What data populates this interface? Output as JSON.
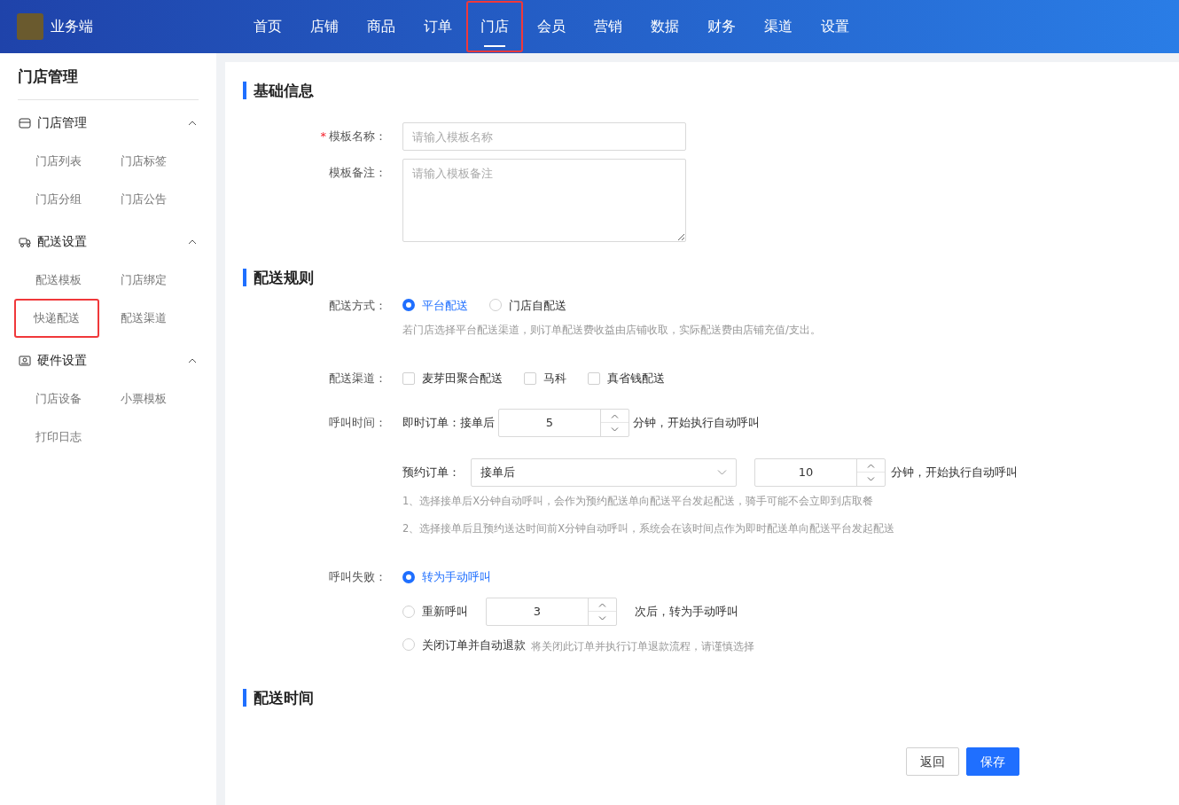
{
  "header": {
    "brand": "业务端",
    "nav": [
      {
        "label": "首页",
        "selected": false,
        "highlighted": false
      },
      {
        "label": "店铺",
        "selected": false,
        "highlighted": false
      },
      {
        "label": "商品",
        "selected": false,
        "highlighted": false
      },
      {
        "label": "订单",
        "selected": false,
        "highlighted": false
      },
      {
        "label": "门店",
        "selected": true,
        "highlighted": true
      },
      {
        "label": "会员",
        "selected": false,
        "highlighted": false
      },
      {
        "label": "营销",
        "selected": false,
        "highlighted": false
      },
      {
        "label": "数据",
        "selected": false,
        "highlighted": false
      },
      {
        "label": "财务",
        "selected": false,
        "highlighted": false
      },
      {
        "label": "渠道",
        "selected": false,
        "highlighted": false
      },
      {
        "label": "设置",
        "selected": false,
        "highlighted": false
      }
    ]
  },
  "sidebar": {
    "title": "门店管理",
    "groups": [
      {
        "label": "门店管理",
        "kind": "store",
        "expanded": true,
        "items": [
          {
            "label": "门店列表",
            "highlighted": false
          },
          {
            "label": "门店标签",
            "highlighted": false
          },
          {
            "label": "门店分组",
            "highlighted": false
          },
          {
            "label": "门店公告",
            "highlighted": false
          }
        ]
      },
      {
        "label": "配送设置",
        "kind": "delivery",
        "expanded": true,
        "items": [
          {
            "label": "配送模板",
            "highlighted": false
          },
          {
            "label": "门店绑定",
            "highlighted": false
          },
          {
            "label": "快递配送",
            "highlighted": true
          },
          {
            "label": "配送渠道",
            "highlighted": false
          }
        ]
      },
      {
        "label": "硬件设置",
        "kind": "hardware",
        "expanded": true,
        "items": [
          {
            "label": "门店设备",
            "highlighted": false
          },
          {
            "label": "小票模板",
            "highlighted": false
          },
          {
            "label": "打印日志",
            "highlighted": false
          }
        ]
      }
    ]
  },
  "basic": {
    "title": "基础信息",
    "name_label": "模板名称：",
    "name_required_mark": "*",
    "name_placeholder": "请输入模板名称",
    "remark_label": "模板备注：",
    "remark_placeholder": "请输入模板备注"
  },
  "rules": {
    "title": "配送规则",
    "method_label": "配送方式：",
    "methods": [
      {
        "label": "平台配送",
        "selected": true
      },
      {
        "label": "门店自配送",
        "selected": false
      }
    ],
    "method_hint": "若门店选择平台配送渠道，则订单配送费收益由店铺收取，实际配送费由店铺充值/支出。",
    "channel_label": "配送渠道：",
    "channels": [
      {
        "label": "麦芽田聚合配送",
        "checked": false
      },
      {
        "label": "马科",
        "checked": false
      },
      {
        "label": "真省钱配送",
        "checked": false
      }
    ],
    "call_label": "呼叫时间：",
    "instant_label": "即时订单：接单后",
    "instant_value": "5",
    "instant_suffix": "分钟，开始执行自动呼叫",
    "reserve_label": "预约订单：",
    "reserve_select": "接单后",
    "reserve_value": "10",
    "reserve_suffix": "分钟，开始执行自动呼叫",
    "reserve_notes": [
      "1、选择接单后X分钟自动呼叫，会作为预约配送单向配送平台发起配送，骑手可能不会立即到店取餐",
      "2、选择接单后且预约送达时间前X分钟自动呼叫，系统会在该时间点作为即时配送单向配送平台发起配送"
    ],
    "fail_label": "呼叫失败：",
    "fail_options": [
      {
        "kind": "plain",
        "label": "转为手动呼叫",
        "selected": true
      },
      {
        "kind": "retry",
        "label": "重新呼叫",
        "selected": false,
        "value": "3",
        "suffix": "次后，转为手动呼叫"
      },
      {
        "kind": "note",
        "label": "关闭订单并自动退款",
        "selected": false,
        "note": "将关闭此订单并执行订单退款流程，请谨慎选择"
      }
    ]
  },
  "time": {
    "title": "配送时间"
  },
  "buttons": [
    {
      "label": "返回",
      "kind": "secondary"
    },
    {
      "label": "保存",
      "kind": "primary"
    }
  ]
}
